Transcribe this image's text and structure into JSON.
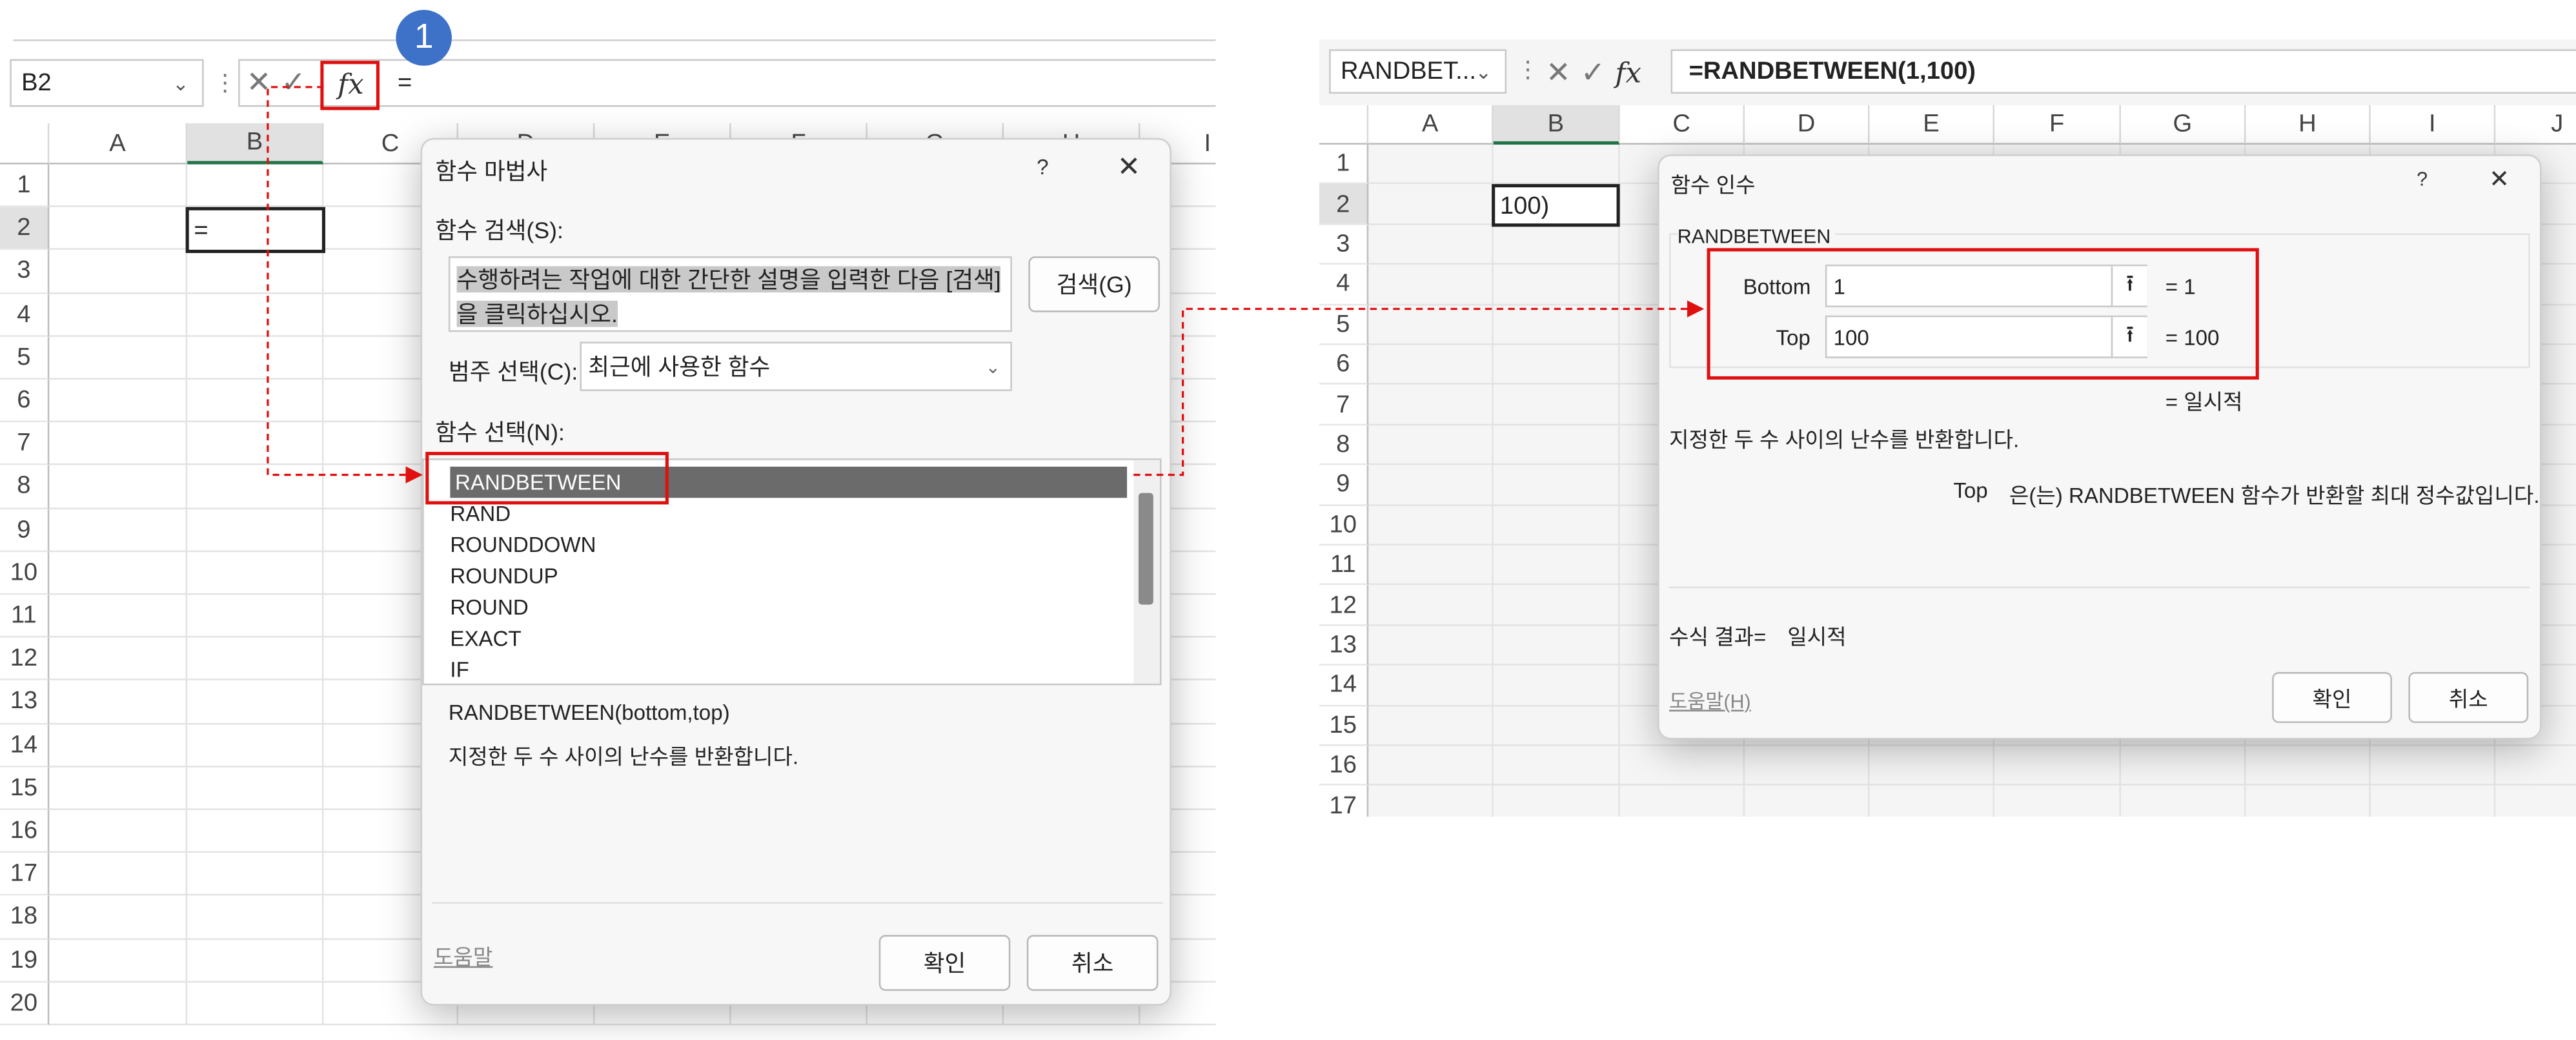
{
  "left": {
    "name_box": "B2",
    "formula": "=",
    "fx_label": "fx",
    "step_badge": "1",
    "columns": [
      "A",
      "B",
      "C",
      "D",
      "E",
      "F",
      "G",
      "H",
      "I"
    ],
    "rows": [
      "1",
      "2",
      "3",
      "4",
      "5",
      "6",
      "7",
      "8",
      "9",
      "10",
      "11",
      "12",
      "13",
      "14",
      "15",
      "16",
      "17",
      "18",
      "19",
      "20"
    ],
    "active_cell_value": "=",
    "dialog": {
      "title": "함수 마법사",
      "help_mark": "?",
      "search_label": "함수 검색(S):",
      "search_text": "수행하려는 작업에 대한 간단한 설명을 입력한 다음 [검색]을 클릭하십시오.",
      "search_button": "검색(G)",
      "category_label": "범주 선택(C):",
      "category_value": "최근에 사용한 함수",
      "function_label": "함수 선택(N):",
      "functions": [
        "RANDBETWEEN",
        "RAND",
        "ROUNDDOWN",
        "ROUNDUP",
        "ROUND",
        "EXACT",
        "IF"
      ],
      "syntax": "RANDBETWEEN(bottom,top)",
      "description": "지정한 두 수 사이의 난수를 반환합니다.",
      "help_link": "도움말",
      "ok": "확인",
      "cancel": "취소"
    }
  },
  "right": {
    "name_box": "RANDBET...",
    "formula": "=RANDBETWEEN(1,100)",
    "fx_label": "fx",
    "columns": [
      "A",
      "B",
      "C",
      "D",
      "E",
      "F",
      "G",
      "H",
      "I",
      "J"
    ],
    "rows": [
      "1",
      "2",
      "3",
      "4",
      "5",
      "6",
      "7",
      "8",
      "9",
      "10",
      "11",
      "12",
      "13",
      "14",
      "15",
      "16",
      "17"
    ],
    "active_cell_value": "100)",
    "dialog": {
      "title": "함수 인수",
      "help_mark": "?",
      "function_name": "RANDBETWEEN",
      "arg1_label": "Bottom",
      "arg1_value": "1",
      "arg1_result": "=  1",
      "arg2_label": "Top",
      "arg2_value": "100",
      "arg2_result": "=  100",
      "overall_result": "=  일시적",
      "description": "지정한 두 수 사이의 난수를 반환합니다.",
      "arg_help_name": "Top",
      "arg_help_text": "은(는) RANDBETWEEN 함수가 반환할 최대 정수값입니다.",
      "formula_result_label": "수식 결과=",
      "formula_result_value": "일시적",
      "help_link": "도움말(H)",
      "ok": "확인",
      "cancel": "취소"
    }
  },
  "colors": {
    "highlight": "#e01010",
    "badge": "#3d72c8",
    "excel_green": "#217346"
  }
}
